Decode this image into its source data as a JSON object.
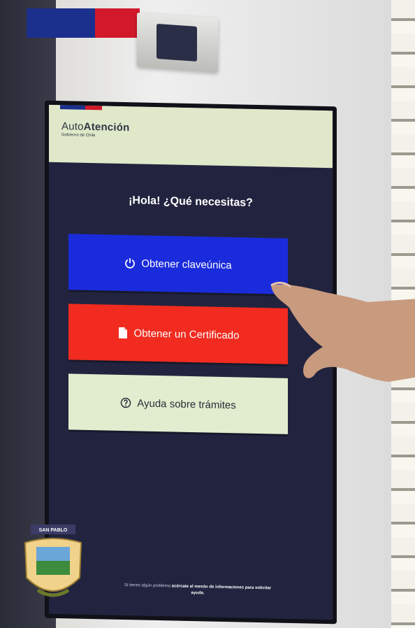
{
  "app": {
    "brand_prefix": "Auto",
    "brand_main": "Atención",
    "brand_sub": "Gobierno de Chile"
  },
  "main": {
    "greeting": "¡Hola! ¿Qué necesitas?",
    "buttons": [
      {
        "label": "Obtener claveúnica",
        "icon": "power-icon",
        "color": "#1a2bdc"
      },
      {
        "label": "Obtener un Certificado",
        "icon": "document-icon",
        "color": "#f12b1f"
      },
      {
        "label": "Ayuda sobre trámites",
        "icon": "help-circle-icon",
        "color": "#e2edcf"
      }
    ]
  },
  "footer": {
    "text_pre": "Si tienes algún problema ",
    "text_bold": "acércate al mesón de informaciones para solicitar",
    "text_end": "ayuda."
  },
  "crest": {
    "label": "SAN PABLO"
  }
}
